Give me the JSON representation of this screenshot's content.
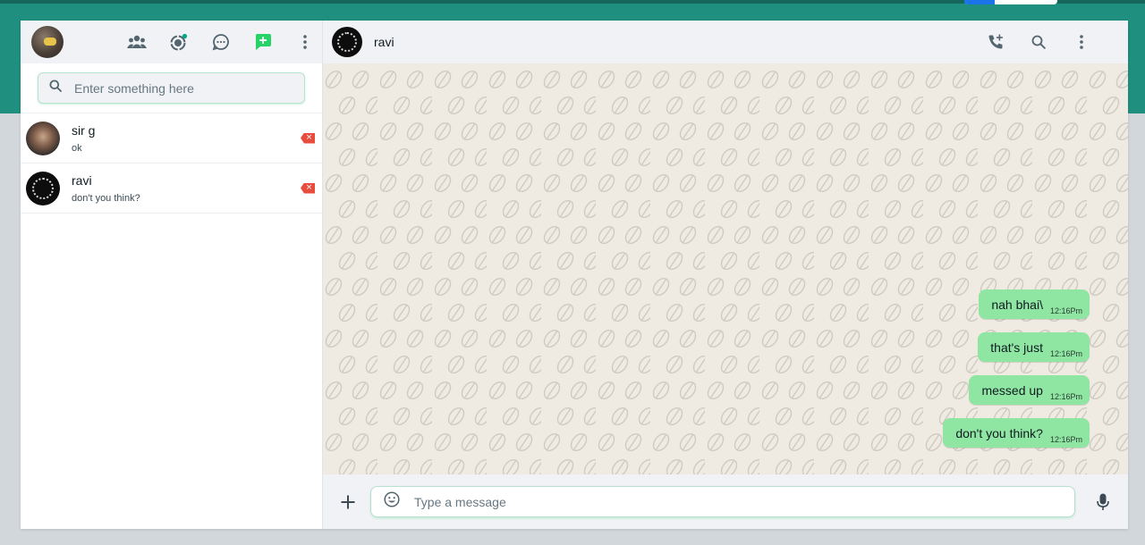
{
  "sidebar": {
    "search_placeholder": "Enter something here",
    "chats": [
      {
        "name": "sir g",
        "last_message": "ok"
      },
      {
        "name": "ravi",
        "last_message": "don't you think?"
      }
    ],
    "header_icons": [
      "user-avatar",
      "community-icon",
      "status-icon",
      "channels-icon",
      "new-chat-icon",
      "menu-icon"
    ]
  },
  "conversation": {
    "contact_name": "ravi",
    "header_icons": [
      "add-call-icon",
      "search-icon",
      "menu-icon"
    ],
    "messages": [
      {
        "text": "nah bhai\\",
        "time": "12:16Pm"
      },
      {
        "text": "that's just",
        "time": "12:16Pm"
      },
      {
        "text": "messed up",
        "time": "12:16Pm"
      },
      {
        "text": "don't you think?",
        "time": "12:16Pm"
      }
    ],
    "composer_placeholder": "Type a message"
  },
  "colors": {
    "brand_band": "#1f8f7f",
    "panel_header": "#f0f2f5",
    "chat_background": "#efeae2",
    "outgoing_bubble": "#8ee6a2",
    "accent_green": "#25d366",
    "delete_badge": "#e74c3c"
  }
}
